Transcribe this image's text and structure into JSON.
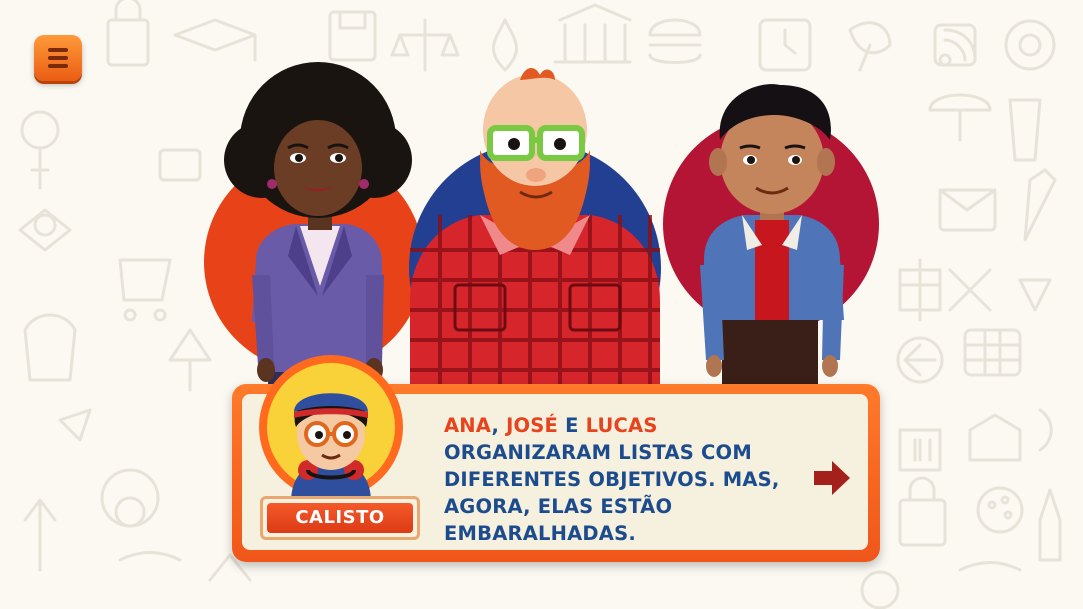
{
  "menu": {
    "icon": "hamburger-menu-icon",
    "color": "#f0701e"
  },
  "characters": [
    {
      "name": "ana",
      "circle_color": "#e84318"
    },
    {
      "name": "jose",
      "circle_color": "#233f92"
    },
    {
      "name": "lucas",
      "circle_color": "#b51535"
    }
  ],
  "dialog": {
    "speaker": "CALISTO",
    "name_ana": "ANA",
    "comma": ", ",
    "name_jose": "JOSÉ",
    "connector": " E ",
    "name_lucas": "LUCAS",
    "line2": "ORGANIZARAM LISTAS COM",
    "line3": "DIFERENTES OBJETIVOS. MAS,",
    "line4": "AGORA, ELAS ESTÃO",
    "line5": "EMBARALHADAS.",
    "next_icon": "right-arrow-icon",
    "text_color": "#1d4c8e",
    "highlight_color": "#e7431d",
    "frame_color": "#f0561a"
  }
}
